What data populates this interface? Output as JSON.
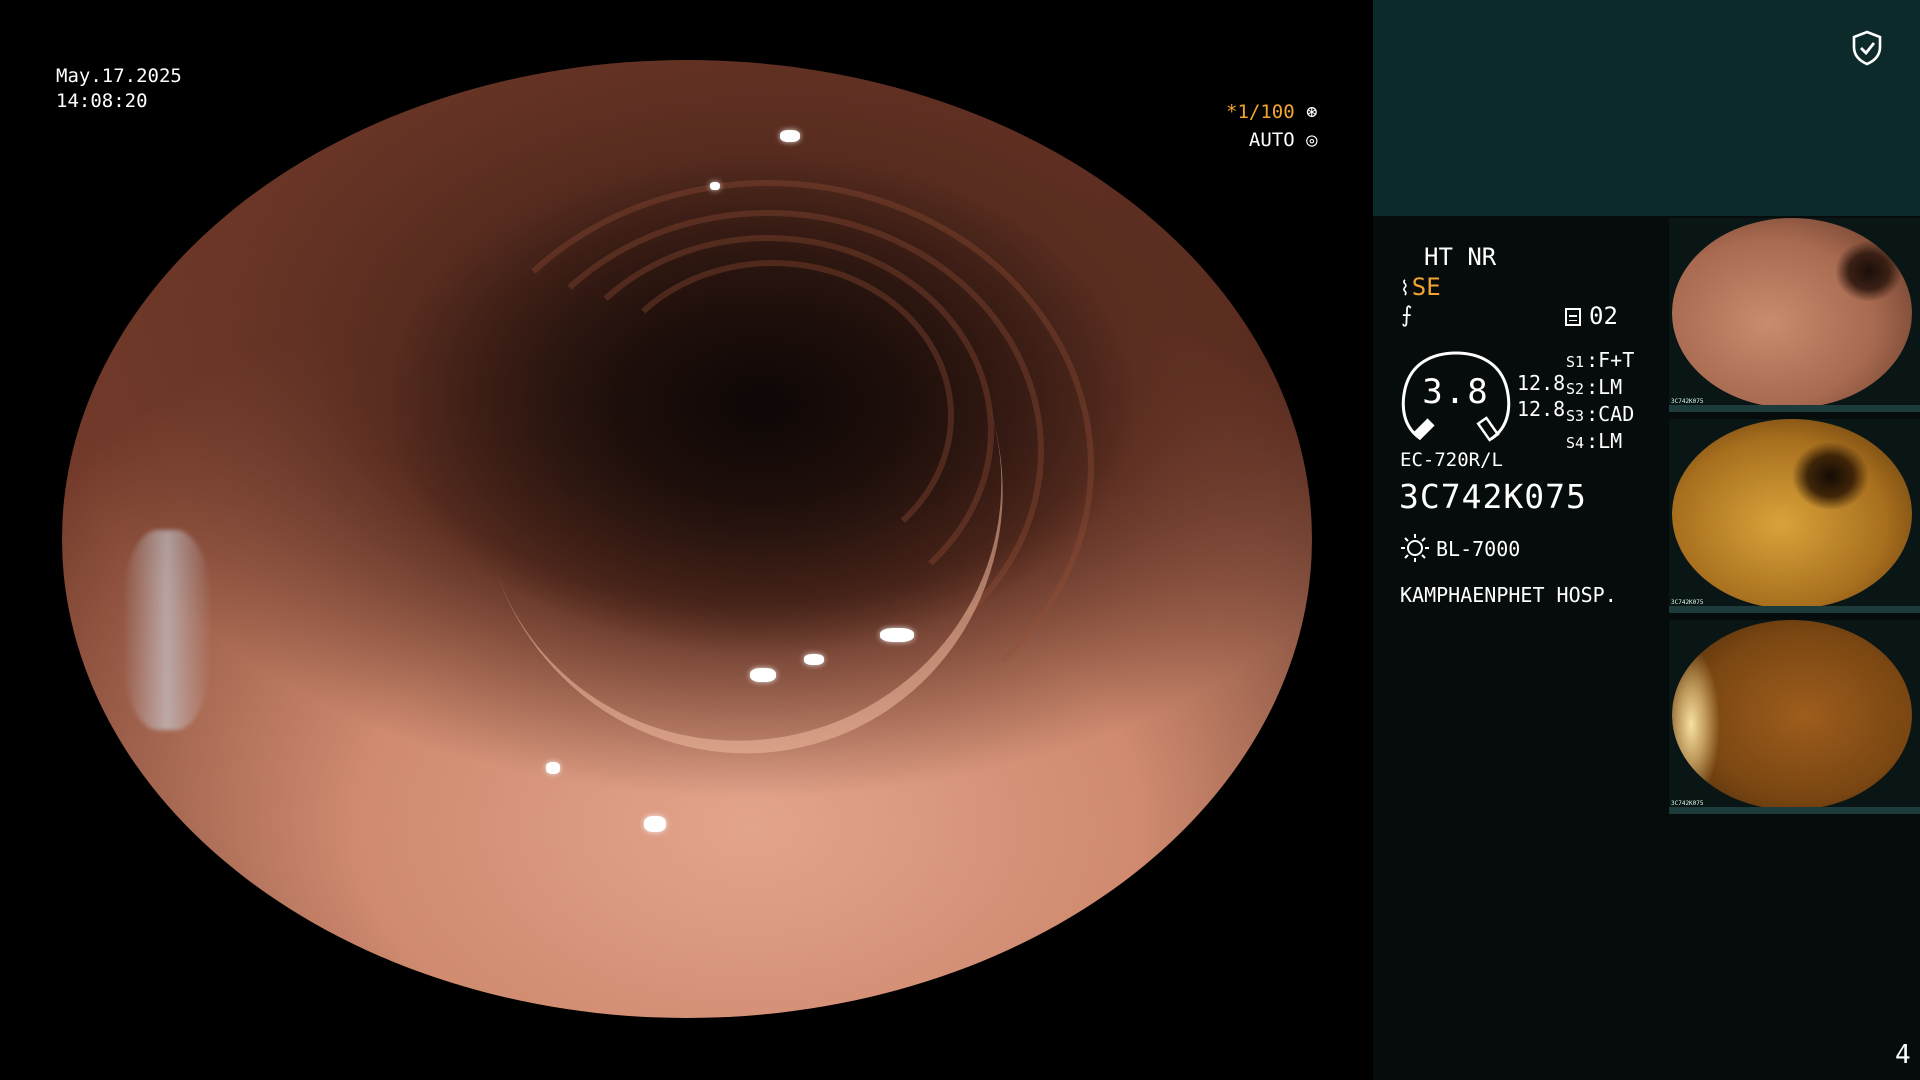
{
  "overlay": {
    "date": "May.17.2025",
    "time": "14:08:20",
    "shutter": "*1/100",
    "iris": "AUTO"
  },
  "panel": {
    "modes": "HT NR",
    "structure_enhance": "SE",
    "memory_label": "02",
    "gauge_value": "3.8",
    "pressure_1": "12.8",
    "pressure_2": "12.8",
    "switches": [
      {
        "key": "S1",
        "value": "F+T"
      },
      {
        "key": "S2",
        "value": "LM"
      },
      {
        "key": "S3",
        "value": "CAD"
      },
      {
        "key": "S4",
        "value": "LM"
      }
    ],
    "scope_model": "EC-720R/L",
    "scope_serial": "3C742K075",
    "light_source": "BL-7000",
    "hospital": "KAMPHAENPHET HOSP.",
    "thumb_serial": "3C742K075",
    "page_number": "4"
  },
  "icons": {
    "shield": "shield-check-icon",
    "shutter": "aperture-icon",
    "iris": "iris-icon",
    "memory": "memory-card-icon",
    "light": "sun-icon"
  },
  "colors": {
    "accent_orange": "#f2a531",
    "panel_top": "#0c2a2a",
    "panel_bg": "#060b0b"
  }
}
